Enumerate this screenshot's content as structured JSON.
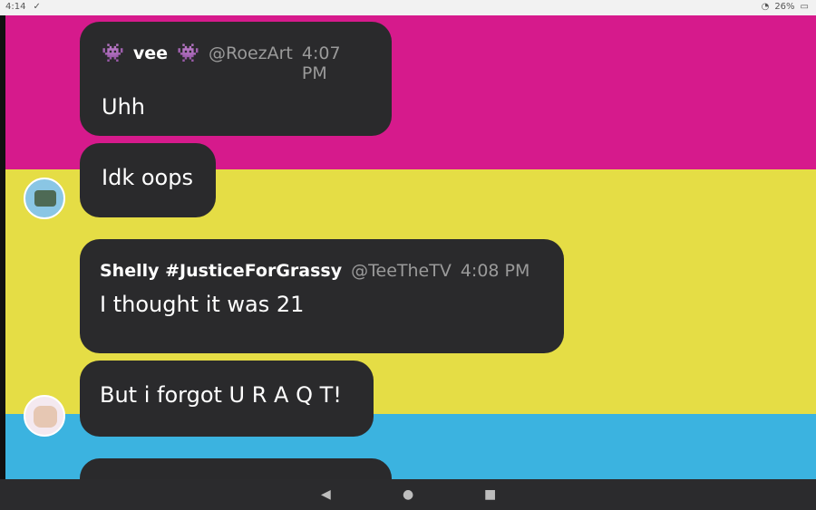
{
  "status": {
    "time": "4:14",
    "battery": "26%"
  },
  "messages": [
    {
      "sender": "vee",
      "handle": "@RoezArt",
      "time": "4:07 PM",
      "texts": [
        "Uhh",
        "Idk oops"
      ]
    },
    {
      "sender": "Shelly #JusticeForGrassy",
      "handle": "@TeeTheTV",
      "time": "4:08 PM",
      "texts": [
        "I thought it was 21",
        "But i forgot U R A Q T!"
      ]
    }
  ],
  "background_colors": {
    "pink": "#d61a8c",
    "yellow": "#e5dd45",
    "blue": "#3bb3e0"
  },
  "icons": {
    "alien": "space-invader",
    "back": "back-icon",
    "home": "home-icon",
    "recents": "recents-icon"
  }
}
